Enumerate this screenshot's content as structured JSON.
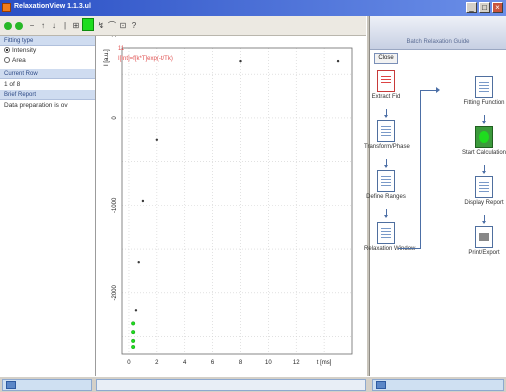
{
  "window": {
    "title": "RelaxationView 1.1.3.ul"
  },
  "toolbar": {
    "icons": [
      "record-green-icon",
      "record-green-icon",
      "minus-icon",
      "up-arrow-icon",
      "down-arrow-icon",
      "select-icon",
      "zoom-icon",
      "curve-icon",
      "fit-icon",
      "help-icon"
    ]
  },
  "left_panel": {
    "fitting_type_header": "Fitting type",
    "options": [
      {
        "label": "Intensity",
        "selected": true
      },
      {
        "label": "Area",
        "selected": false
      }
    ],
    "current_row_header": "Current Row",
    "current_row_value": "1 of 8",
    "brief_report_header": "Brief Report",
    "brief_report_text": "Data preparation is ov"
  },
  "plot": {
    "legend_number": "11",
    "legend_formula": "I[Int]=f[k*T]exp(-t/Tk)"
  },
  "chart_data": {
    "type": "scatter",
    "x": [
      0.3,
      0.3,
      0.3,
      0.3,
      0.5,
      0.7,
      1.0,
      2.0,
      8.0,
      15.0
    ],
    "y": [
      -2350,
      -2450,
      -2550,
      -2620,
      -2200,
      -1650,
      -950,
      -250,
      650,
      650
    ],
    "xticks": [
      "0",
      "2",
      "4",
      "6",
      "8",
      "10",
      "12",
      "t [ms]"
    ],
    "yticks": [
      "-2000",
      "-1000",
      "0",
      "1000"
    ],
    "xlim": [
      -0.5,
      16
    ],
    "ylim": [
      -2700,
      800
    ],
    "ylabel": "I [a.u.]",
    "grid": true
  },
  "right_panel": {
    "header": "Batch Relaxation Guide",
    "close_label": "Close",
    "steps_left": [
      {
        "label": "Extract Fid",
        "icon": "extract-fid-icon"
      },
      {
        "label": "Transform/Phase",
        "icon": "transform-phase-icon"
      },
      {
        "label": "Define Ranges",
        "icon": "define-ranges-icon"
      },
      {
        "label": "Relaxation Window",
        "icon": "relaxation-window-icon"
      }
    ],
    "steps_right": [
      {
        "label": "Fitting Function",
        "icon": "fitting-function-icon"
      },
      {
        "label": "Start Calculation",
        "icon": "start-calculation-icon"
      },
      {
        "label": "Display Report",
        "icon": "display-report-icon"
      },
      {
        "label": "Print/Export",
        "icon": "print-export-icon"
      }
    ]
  },
  "colors": {
    "titlebar": "#2a4fc4",
    "accent_green": "#1edc1e",
    "data_points": "#3a3a3a",
    "legend_text": "#e05050"
  }
}
